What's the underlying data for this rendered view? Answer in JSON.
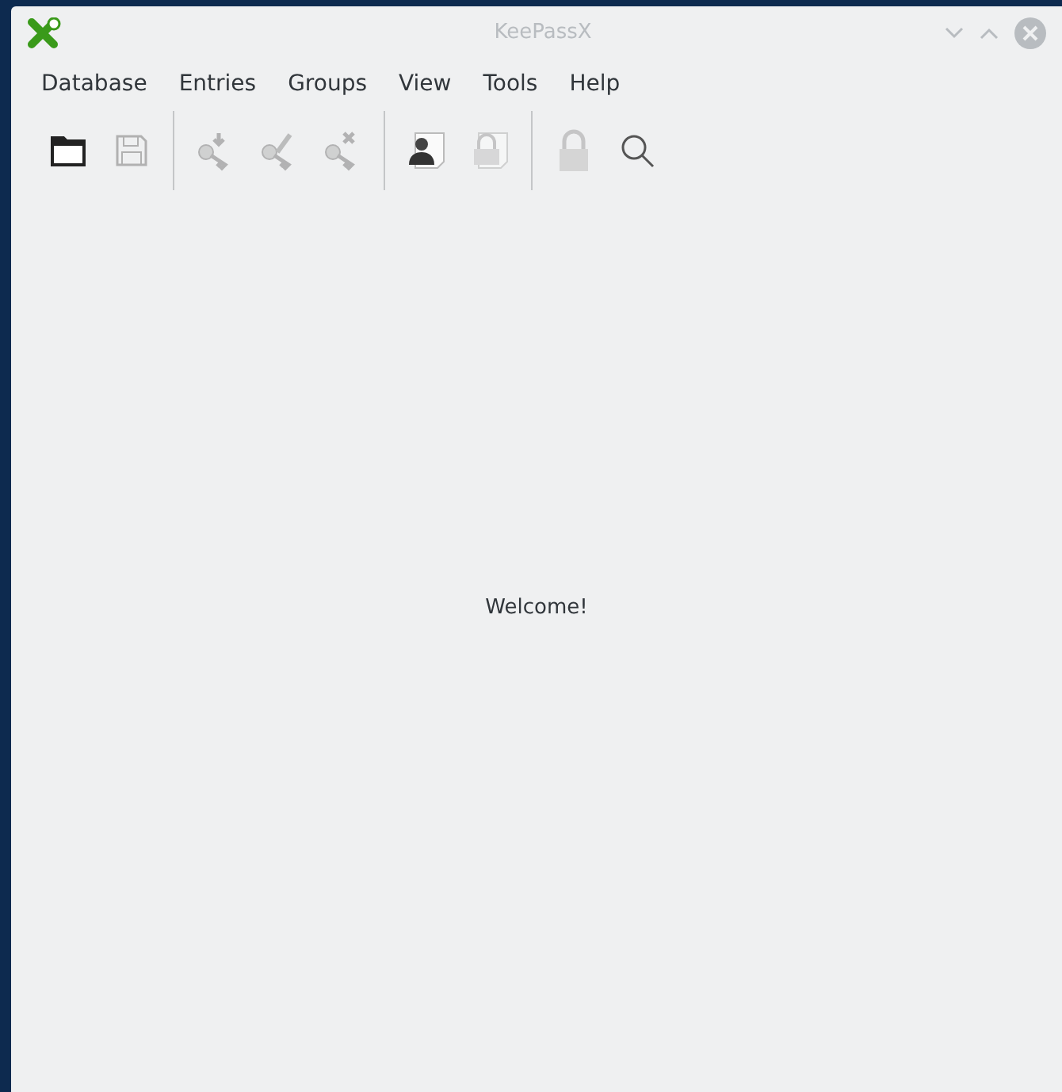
{
  "window": {
    "title": "KeePassX"
  },
  "menu": [
    "Database",
    "Entries",
    "Groups",
    "View",
    "Tools",
    "Help"
  ],
  "toolbar": [
    {
      "kind": "open",
      "disabled": false
    },
    {
      "kind": "save",
      "disabled": true
    },
    {
      "kind": "separator"
    },
    {
      "kind": "add-entry",
      "disabled": true
    },
    {
      "kind": "edit-entry",
      "disabled": true
    },
    {
      "kind": "delete-entry",
      "disabled": true
    },
    {
      "kind": "separator"
    },
    {
      "kind": "copy-username",
      "disabled": false
    },
    {
      "kind": "copy-password",
      "disabled": true
    },
    {
      "kind": "separator"
    },
    {
      "kind": "lock",
      "disabled": true
    },
    {
      "kind": "search",
      "disabled": false
    }
  ],
  "content": {
    "message": "Welcome!"
  }
}
